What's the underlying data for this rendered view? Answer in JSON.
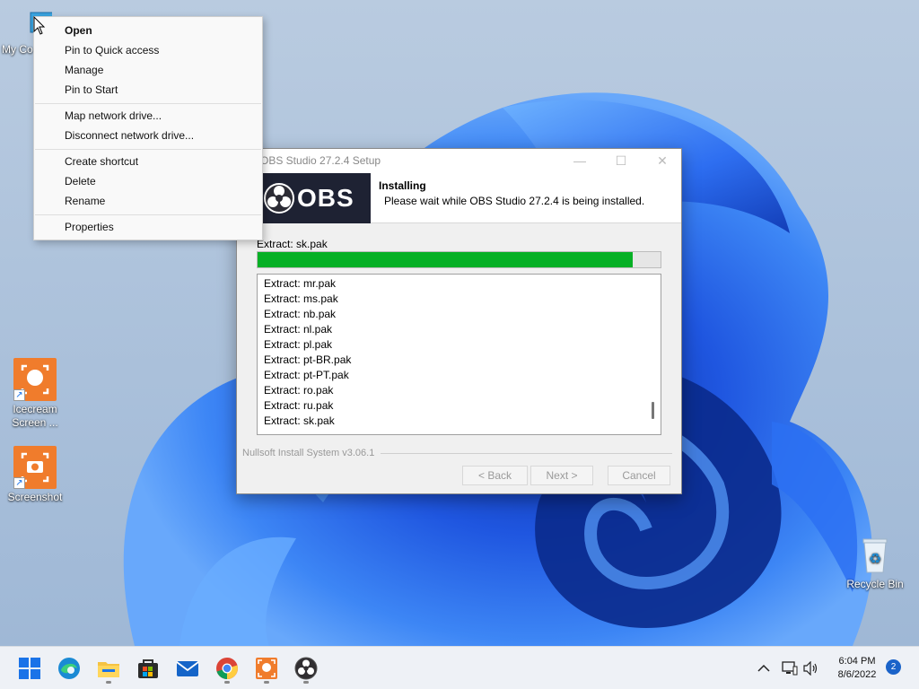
{
  "desktop": {
    "icons": [
      {
        "label": "My Co",
        "name": "my-computer"
      },
      {
        "label": "Icecream Screen ...",
        "name": "icecream-screen-recorder"
      },
      {
        "label": "Screenshot",
        "name": "screenshot"
      },
      {
        "label": "Recycle Bin",
        "name": "recycle-bin"
      }
    ]
  },
  "context_menu": {
    "items": [
      {
        "label": "Open",
        "default": true
      },
      {
        "label": "Pin to Quick access"
      },
      {
        "label": "Manage"
      },
      {
        "label": "Pin to Start"
      },
      {
        "label": "Map network drive..."
      },
      {
        "label": "Disconnect network drive..."
      },
      {
        "label": "Create shortcut"
      },
      {
        "label": "Delete"
      },
      {
        "label": "Rename"
      },
      {
        "label": "Properties"
      }
    ]
  },
  "installer": {
    "title": "OBS Studio 27.2.4 Setup",
    "logo_text": "OBS",
    "header_title": "Installing",
    "header_subtitle": "Please wait while OBS Studio 27.2.4 is being installed.",
    "status": "Extract: sk.pak",
    "progress_percent": 93,
    "log": [
      "Extract: mr.pak",
      "Extract: ms.pak",
      "Extract: nb.pak",
      "Extract: nl.pak",
      "Extract: pl.pak",
      "Extract: pt-BR.pak",
      "Extract: pt-PT.pak",
      "Extract: ro.pak",
      "Extract: ru.pak",
      "Extract: sk.pak"
    ],
    "branding": "Nullsoft Install System v3.06.1",
    "buttons": {
      "back": "< Back",
      "next": "Next >",
      "cancel": "Cancel"
    }
  },
  "taskbar": {
    "apps": [
      "start",
      "edge",
      "file-explorer",
      "microsoft-store",
      "mail",
      "chrome",
      "icecream-screen-recorder",
      "obs-studio"
    ],
    "time": "6:04 PM",
    "date": "8/6/2022",
    "notification_count": "2"
  },
  "colors": {
    "progress_fill": "#06b025",
    "obs_banner": "#1e2233",
    "accent": "#1a63c9"
  }
}
